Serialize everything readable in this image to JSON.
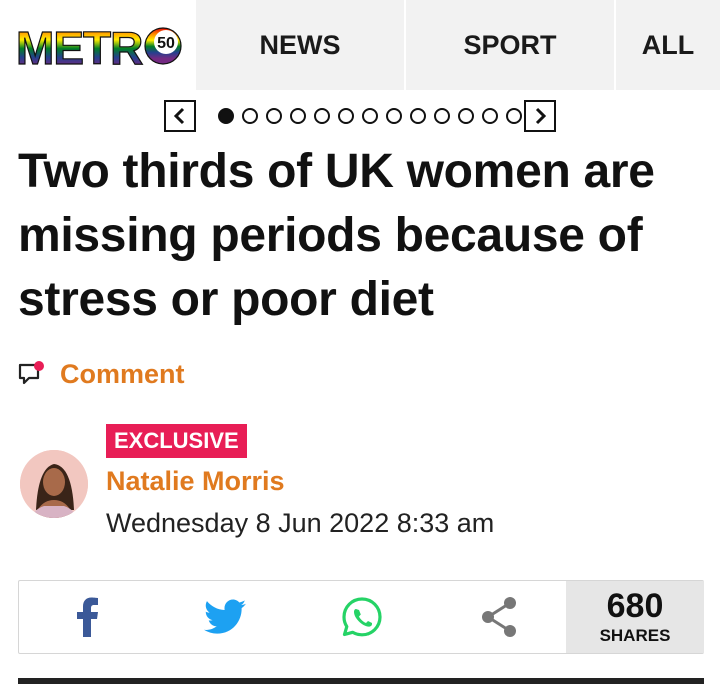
{
  "nav": {
    "logo_text": "METRO",
    "logo_badge": "50",
    "tabs": [
      "NEWS",
      "SPORT",
      "ALL"
    ]
  },
  "carousel": {
    "prev_icon": "chevron-left-icon",
    "next_icon": "chevron-right-icon",
    "dot_count": 13,
    "active_index": 0
  },
  "article": {
    "headline": "Two thirds of UK women are missing periods because of stress or poor diet",
    "comment_label": "Comment",
    "badge": "EXCLUSIVE",
    "author": "Natalie Morris",
    "date": "Wednesday 8 Jun 2022 8:33 am"
  },
  "share": {
    "buttons": [
      "facebook-icon",
      "twitter-icon",
      "whatsapp-icon",
      "share-icon"
    ],
    "count": "680",
    "count_label": "SHARES"
  },
  "colors": {
    "accent": "#e07a1f",
    "badge": "#e81e56",
    "facebook": "#3b5998",
    "twitter": "#1da1f2",
    "whatsapp": "#25d366",
    "nav_bg": "#f2f2f2"
  }
}
